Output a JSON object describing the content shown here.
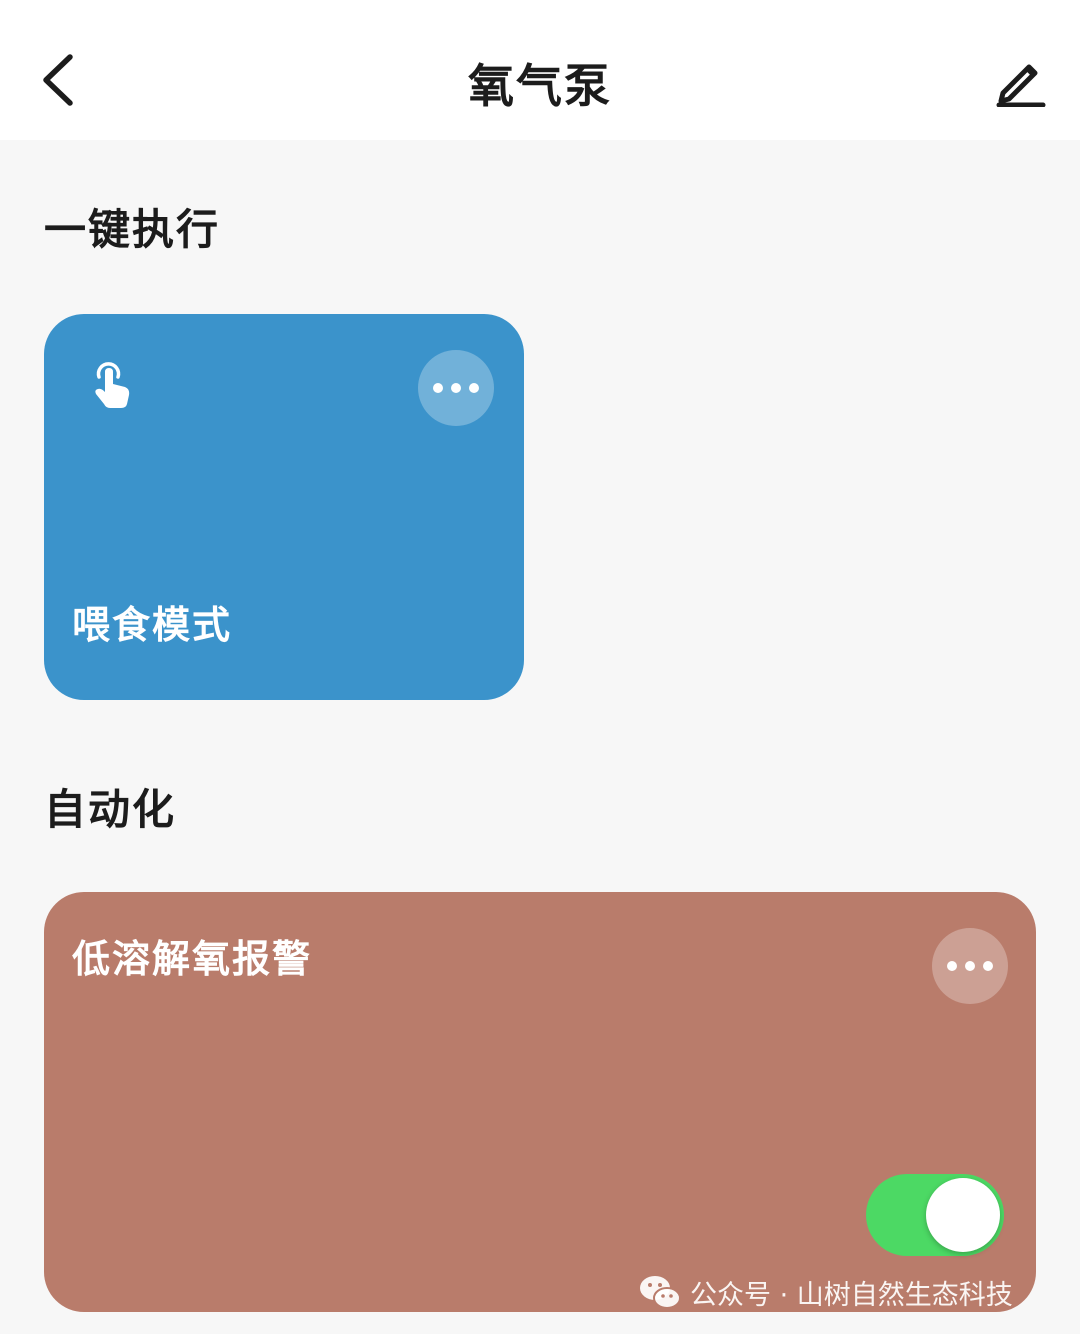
{
  "header": {
    "title": "氧气泵",
    "back_icon": "chevron-left-icon",
    "edit_icon": "pencil-icon"
  },
  "sections": {
    "one_click": {
      "title": "一键执行",
      "card": {
        "label": "喂食模式",
        "icon": "tap-hand-icon",
        "color": "#3b93cb"
      }
    },
    "automation": {
      "title": "自动化",
      "card": {
        "label": "低溶解氧报警",
        "color": "#b97c6b",
        "toggle_on": true,
        "toggle_color": "#4cd964"
      }
    }
  },
  "watermark": {
    "text": "公众号 · 山树自然生态科技",
    "icon": "wechat-icon"
  }
}
